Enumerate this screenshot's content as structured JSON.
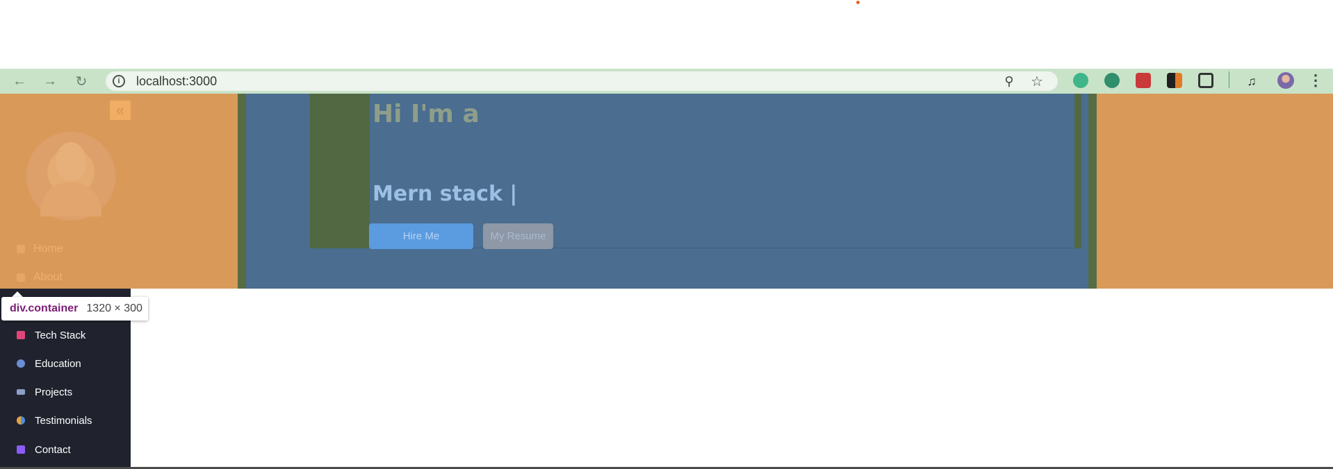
{
  "browser": {
    "url": "localhost:3000",
    "icons": [
      "back-arrow-icon",
      "forward-arrow-icon",
      "reload-icon",
      "site-info-icon",
      "zoom-icon",
      "bookmark-star-icon",
      "extensions-icon",
      "menu-kebab-icon"
    ]
  },
  "sidebar": {
    "collapse_icon": "«",
    "tinted_items": [
      {
        "label": "Home",
        "icon": "home-icon"
      },
      {
        "label": "About",
        "icon": "about-icon"
      }
    ],
    "items": [
      {
        "label": "Tech Stack",
        "icon": "hourglass-icon",
        "color": "#e0457b"
      },
      {
        "label": "Education",
        "icon": "graduate-icon",
        "color": "#6b8dd6"
      },
      {
        "label": "Projects",
        "icon": "projects-icon",
        "color": "#8ba0c9"
      },
      {
        "label": "Testimonials",
        "icon": "testimonials-icon",
        "color": "#e6a23c"
      },
      {
        "label": "Contact",
        "icon": "contact-icon",
        "color": "#8b5cf6"
      }
    ]
  },
  "hero": {
    "greeting": "Hi I'm a",
    "role": "Mern stack |",
    "hire_label": "Hire Me",
    "resume_label": "My Resume"
  },
  "devtools_tooltip": {
    "selector": "div.container",
    "dimensions": "1320 × 300"
  },
  "colors": {
    "margin_tint": "#d99a59",
    "padding_tint": "#566c44",
    "content_tint": "#4a6d90",
    "sidebar_bg": "#20232e"
  }
}
